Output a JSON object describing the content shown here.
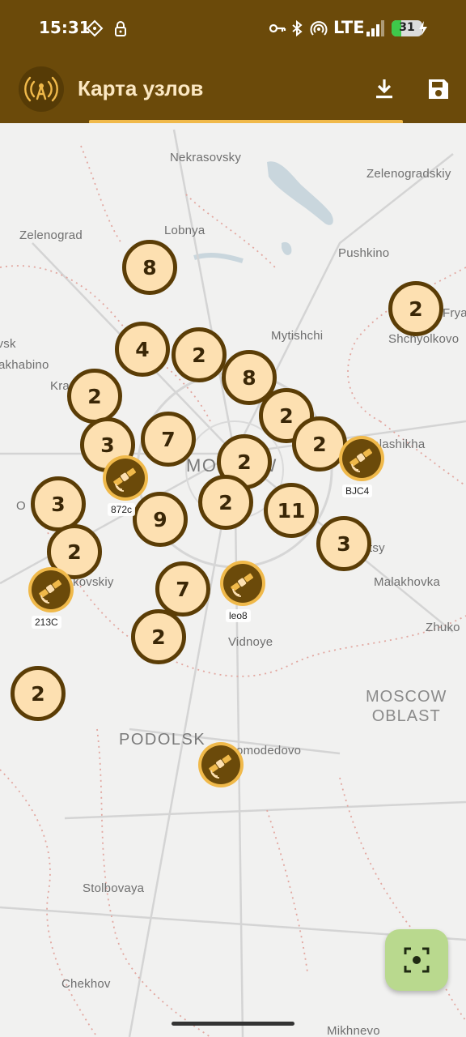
{
  "status_bar": {
    "time": "15:31",
    "network": "LTE",
    "battery_level": "31",
    "battery_fraction": 0.31,
    "icons": [
      "data-saver-icon",
      "vpn-lock-icon",
      "key-icon",
      "bluetooth-icon",
      "hotspot-icon",
      "signal-icon",
      "charging-icon"
    ]
  },
  "app_bar": {
    "title": "Карта узлов",
    "logo_icon": "antenna-icon",
    "actions": [
      "download-icon",
      "save-icon"
    ]
  },
  "colors": {
    "primary": "#6b4a0a",
    "accent": "#f0b94a",
    "cluster_fill": "#fde0b1",
    "fab": "#b9d98e"
  },
  "map": {
    "places": {
      "nekrasovsky": "Nekrasovsky",
      "zelenogradskiy": "Zelenogradskiy",
      "zelenograd": "Zelenograd",
      "lobnya": "Lobnya",
      "pushkino": "Pushkino",
      "fryazino": "Frya",
      "shchyolkovo": "Shchyolkovo",
      "mytishchi": "Mytishchi",
      "vsk": "ovsk",
      "khimki": "akhabino",
      "krasnogorsk": "Kra",
      "moscow": "MOSCOW",
      "balashikha": "Balashikha",
      "odintsovo": "O",
      "lyubertsy": "tsy",
      "malakhovka": "Malakhovka",
      "zhukovsky": "Zhuko",
      "kovskiy": "kovskiy",
      "vidnoye": "Vidnoye",
      "moscow_oblast_line1": "MOSCOW",
      "moscow_oblast_line2": "OBLAST",
      "podolsk": "PODOLSK",
      "domodedovo": "Domodedovo",
      "stolbovaya": "Stolbovaya",
      "chekhov": "Chekhov",
      "mikhnevo": "Mikhnevo"
    },
    "clusters": [
      "8",
      "2",
      "4",
      "2",
      "8",
      "2",
      "2",
      "3",
      "7",
      "2",
      "2",
      "3",
      "2",
      "9",
      "2",
      "11",
      "3",
      "7",
      "2",
      "2"
    ],
    "nodes": [
      {
        "label": "872c",
        "icon": "satellite-icon"
      },
      {
        "label": "BJC4",
        "icon": "satellite-icon"
      },
      {
        "label": "213C",
        "icon": "satellite-icon"
      },
      {
        "label": "leo8",
        "icon": "satellite-icon"
      },
      {
        "label": "",
        "icon": "satellite-icon"
      }
    ]
  },
  "fab": {
    "icon": "center-focus-icon"
  }
}
